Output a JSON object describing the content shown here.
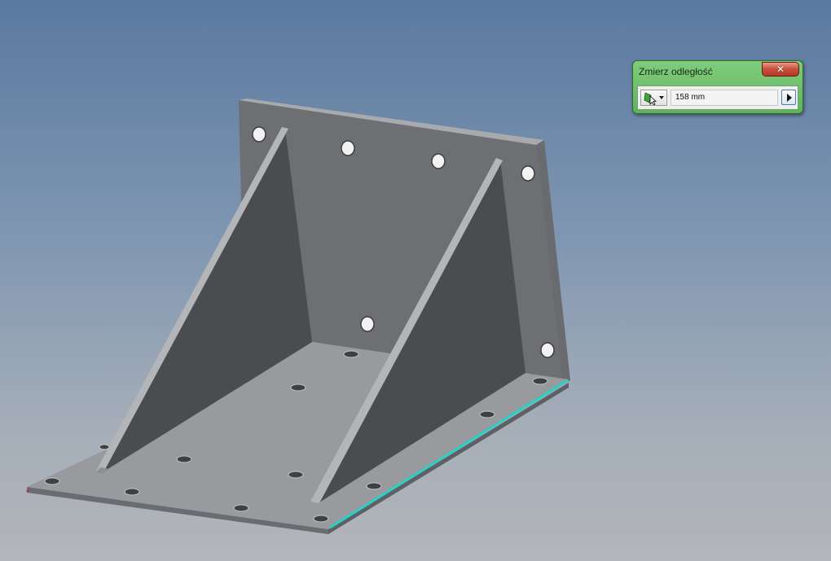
{
  "dialog": {
    "title": "Zmierz odległość",
    "close_icon": "close-icon",
    "select_icon": "cursor-select-icon",
    "distance_value": "158 mm",
    "expand_icon": "play-arrow-icon"
  },
  "colors": {
    "dialog_green": "#6cbf69",
    "close_red": "#c8503a",
    "highlight_edge": "#27d1c8",
    "part_face_light": "#9a9b9e",
    "part_face_dark": "#4b4c50"
  }
}
